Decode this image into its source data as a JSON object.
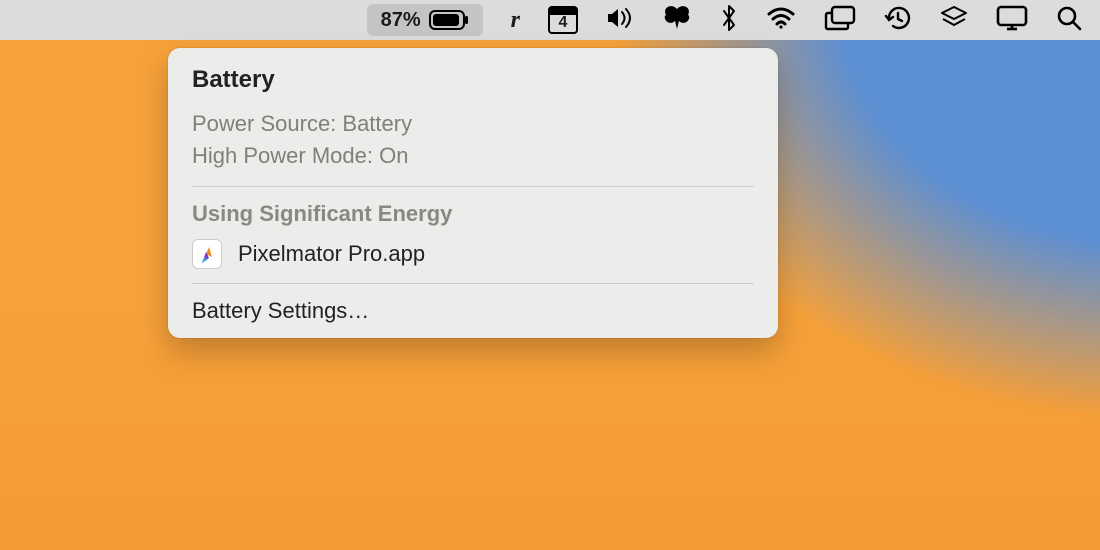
{
  "menubar": {
    "battery_percent": "87%",
    "calendar_day": "4",
    "r_label": "r"
  },
  "panel": {
    "title": "Battery",
    "power_source_line": "Power Source: Battery",
    "high_power_line": "High Power Mode: On",
    "energy_heading": "Using Significant Energy",
    "apps": [
      {
        "name": "Pixelmator Pro.app"
      }
    ],
    "settings_label": "Battery Settings…"
  }
}
